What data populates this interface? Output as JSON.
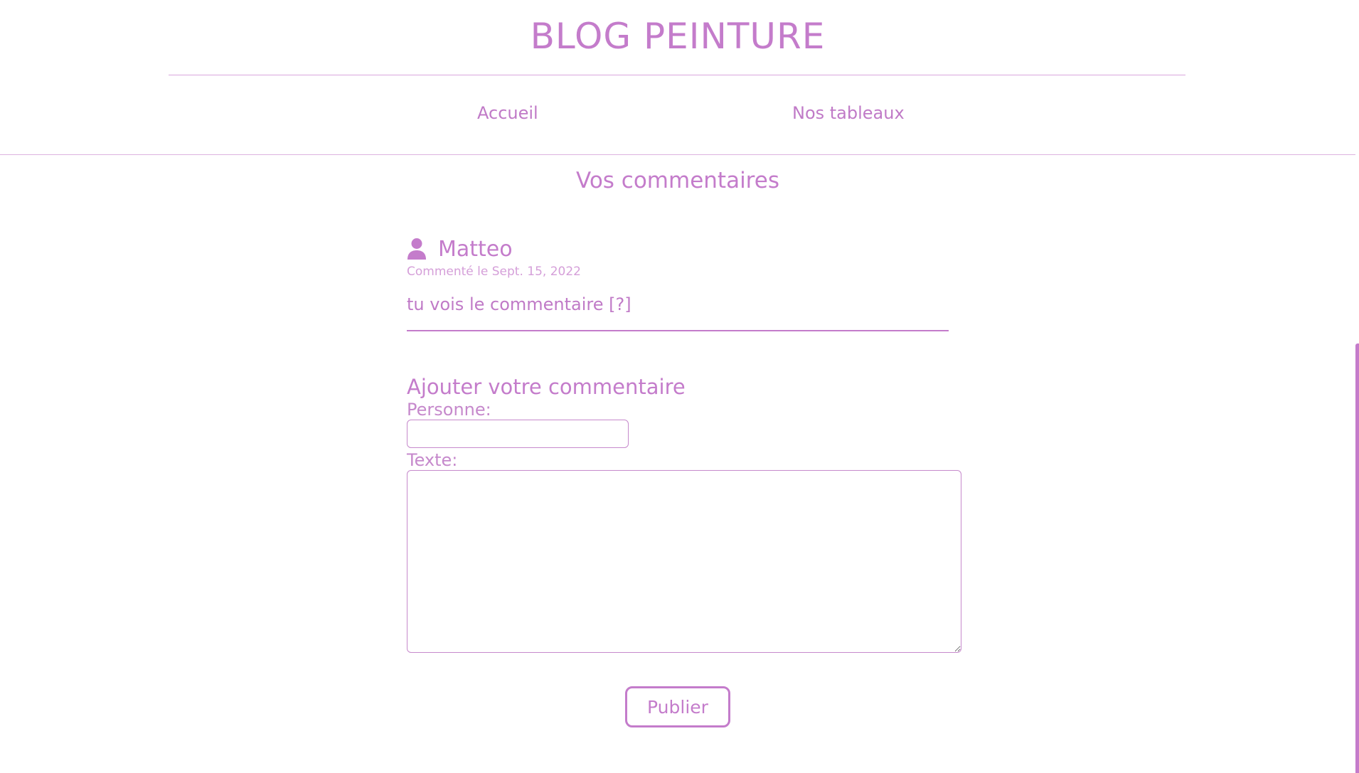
{
  "header": {
    "site_title": "BLOG PEINTURE"
  },
  "nav": {
    "items": [
      {
        "label": "Accueil"
      },
      {
        "label": "Nos tableaux"
      }
    ]
  },
  "comments_section": {
    "title": "Vos commentaires",
    "comments": [
      {
        "icon": "person-icon",
        "author": "Matteo",
        "date": "Commenté le Sept. 15, 2022",
        "text": "tu vois le commentaire [?]"
      }
    ]
  },
  "comment_form": {
    "title": "Ajouter votre commentaire",
    "person_label": "Personne:",
    "person_value": "",
    "text_label": "Texte:",
    "text_value": "",
    "submit_label": "Publier"
  },
  "colors": {
    "accent": "#c47ccb",
    "background": "#ffffff"
  }
}
